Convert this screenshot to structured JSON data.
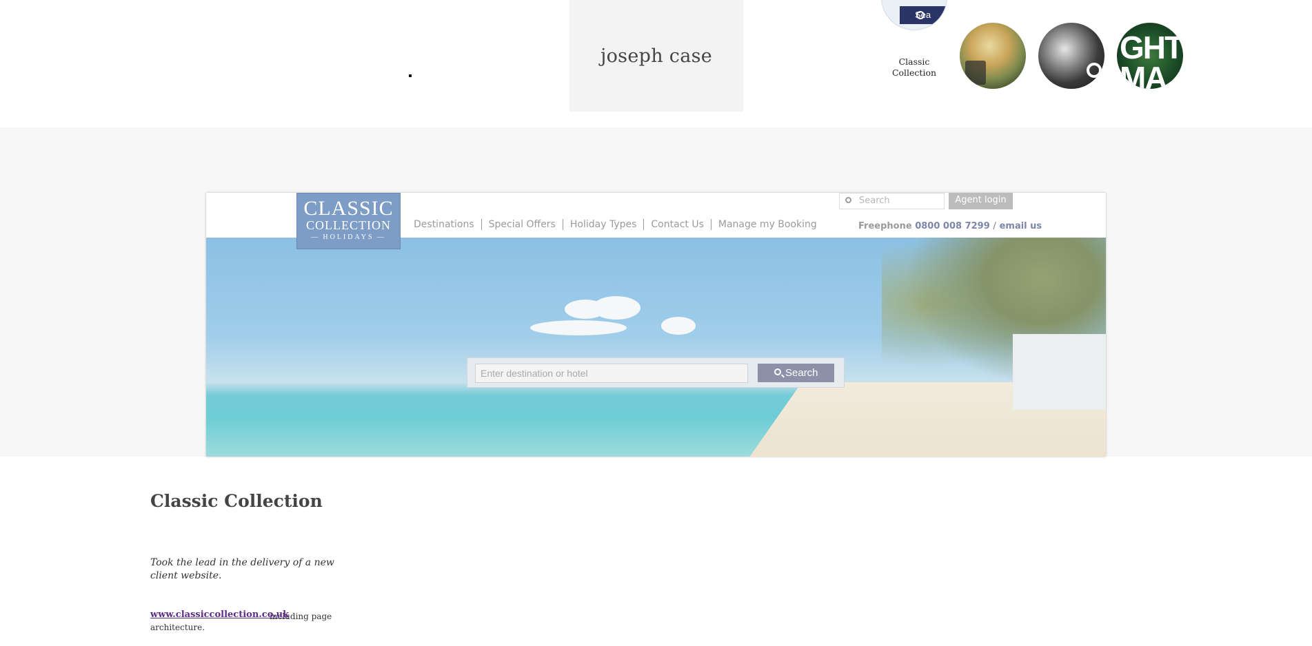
{
  "header": {
    "name": "joseph case",
    "thumbnails": [
      {
        "label": "Classic Collection",
        "mini_button": "Sea"
      },
      {
        "label": ""
      },
      {
        "label": ""
      },
      {
        "label": "",
        "text": "GHT MA"
      }
    ]
  },
  "embedded_site": {
    "logo": {
      "line1": "CLASSIC",
      "line2": "COLLECTION",
      "line3": "HOLIDAYS"
    },
    "nav": [
      "Destinations",
      "Special Offers",
      "Holiday Types",
      "Contact Us",
      "Manage my Booking"
    ],
    "search_placeholder": "Search",
    "agent_login": "Agent login",
    "freephone_label": "Freephone",
    "phone": "0800 008 7299",
    "separator": "/",
    "email": "email us",
    "hero_search_placeholder": "Enter destination or hotel",
    "hero_search_button": "Search"
  },
  "content": {
    "title": "Classic Collection",
    "lead": "Took the lead in the delivery of a new client website.",
    "link": "www.classiccollection.co.uk",
    "description": "including page architecture."
  },
  "colors": {
    "logo_bg": "#7d9cc6",
    "link": "#5c2c86",
    "button": "#8d90a8"
  }
}
